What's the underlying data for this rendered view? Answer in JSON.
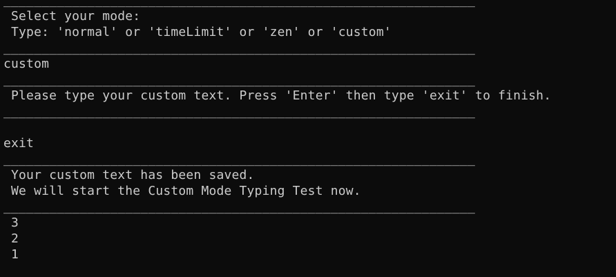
{
  "terminal": {
    "lines": [
      "______________________________________________________________",
      " Select your mode:",
      " Type: 'normal' or 'timeLimit' or 'zen' or 'custom'",
      "______________________________________________________________",
      "custom",
      "______________________________________________________________",
      " Please type your custom text. Press 'Enter' then type 'exit' to finish.",
      "______________________________________________________________",
      "",
      "exit",
      "______________________________________________________________",
      " Your custom text has been saved.",
      " We will start the Custom Mode Typing Test now.",
      "______________________________________________________________",
      " 3",
      " 2",
      " 1"
    ]
  }
}
